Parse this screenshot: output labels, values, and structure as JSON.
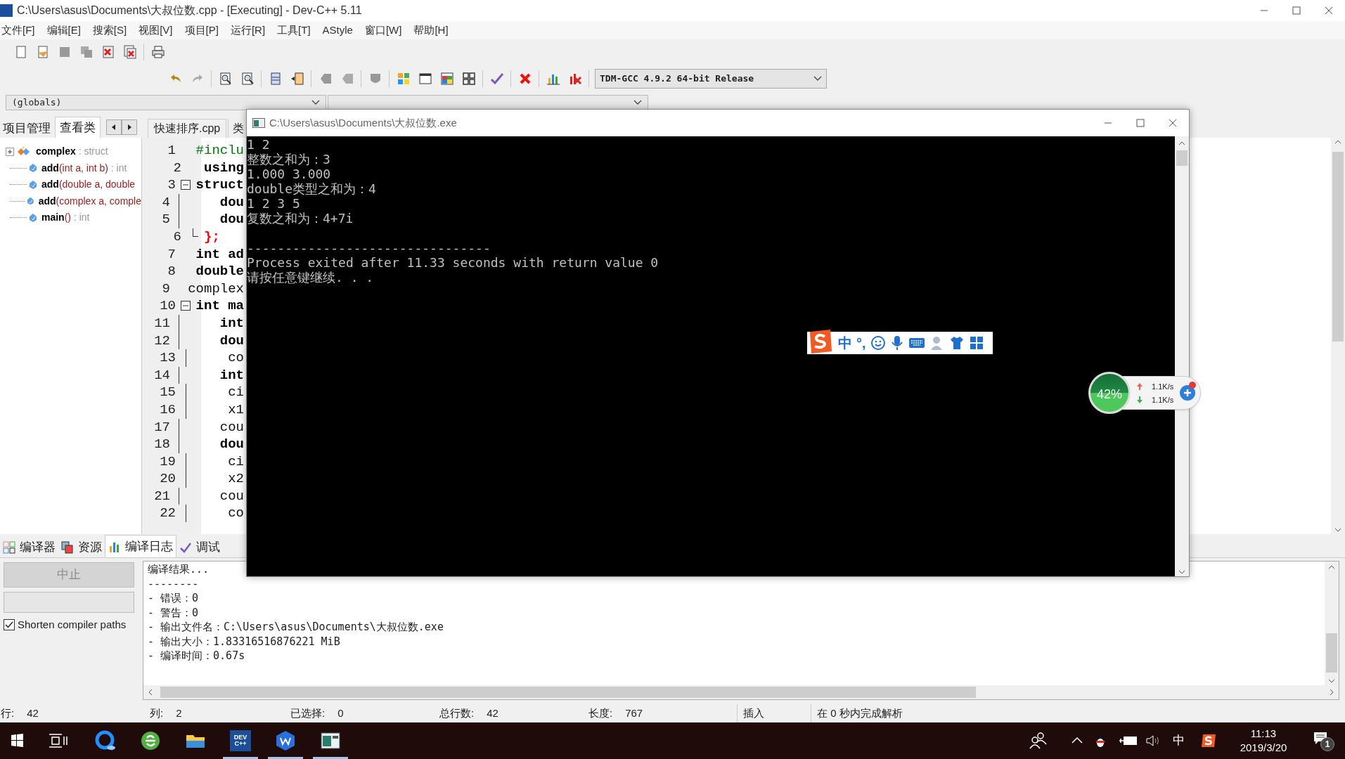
{
  "window": {
    "title": "C:\\Users\\asus\\Documents\\大叔位数.cpp - [Executing] - Dev-C++ 5.11"
  },
  "menu": [
    "文件[F]",
    "编辑[E]",
    "搜索[S]",
    "视图[V]",
    "项目[P]",
    "运行[R]",
    "工具[T]",
    "AStyle",
    "窗口[W]",
    "帮助[H]"
  ],
  "compiler_select": {
    "value": "TDM-GCC 4.9.2 64-bit Release"
  },
  "scope_select": {
    "value": "(globals)"
  },
  "left_tabs": [
    {
      "label": "项目管理",
      "selected": false
    },
    {
      "label": "查看类",
      "selected": true
    }
  ],
  "class_tree": [
    {
      "name": "complex",
      "type": ": struct",
      "kind": "struct",
      "expanded": false
    },
    {
      "name": "add",
      "params": "(int a, int b)",
      "type": ": int",
      "kind": "function"
    },
    {
      "name": "add",
      "params": "(double a, double",
      "kind": "function"
    },
    {
      "name": "add",
      "params": "(complex a, comple",
      "kind": "function"
    },
    {
      "name": "main",
      "params": "()",
      "type": ": int",
      "kind": "function"
    }
  ],
  "editor_tabs": [
    "快速排序.cpp",
    "类"
  ],
  "code_lines": [
    {
      "number": "1",
      "code": "#inclu",
      "kind": "directive",
      "fold_marker": false,
      "in_fold": false
    },
    {
      "number": "2",
      "code": "using",
      "kind": "keyword",
      "fold_marker": false,
      "in_fold": false
    },
    {
      "number": "3",
      "code": "struct",
      "kind": "keyword",
      "fold_marker": true,
      "in_fold": false
    },
    {
      "number": "4",
      "code": "    dou",
      "kind": "keyword",
      "fold_marker": false,
      "in_fold": true
    },
    {
      "number": "5",
      "code": "    dou",
      "kind": "keyword",
      "fold_marker": false,
      "in_fold": true
    },
    {
      "number": "6",
      "code": "};",
      "kind": "punct",
      "fold_marker": false,
      "in_fold": true
    },
    {
      "number": "7",
      "code": "int ad",
      "kind": "keyword",
      "fold_marker": false,
      "in_fold": false
    },
    {
      "number": "8",
      "code": "double",
      "kind": "keyword",
      "fold_marker": false,
      "in_fold": false
    },
    {
      "number": "9",
      "code": "complex",
      "kind": "plain",
      "fold_marker": false,
      "in_fold": false
    },
    {
      "number": "10",
      "code": "int ma",
      "kind": "keyword",
      "fold_marker": true,
      "in_fold": false
    },
    {
      "number": "11",
      "code": "    int",
      "kind": "keyword",
      "fold_marker": false,
      "in_fold": true
    },
    {
      "number": "12",
      "code": "    dou",
      "kind": "keyword",
      "fold_marker": false,
      "in_fold": true
    },
    {
      "number": "13",
      "code": "    co",
      "kind": "plain",
      "fold_marker": false,
      "in_fold": true
    },
    {
      "number": "14",
      "code": "    int",
      "kind": "keyword",
      "fold_marker": false,
      "in_fold": true
    },
    {
      "number": "15",
      "code": "    ci",
      "kind": "plain",
      "fold_marker": false,
      "in_fold": true
    },
    {
      "number": "16",
      "code": "    x1",
      "kind": "plain",
      "fold_marker": false,
      "in_fold": true
    },
    {
      "number": "17",
      "code": "    cou",
      "kind": "plain",
      "fold_marker": false,
      "in_fold": true
    },
    {
      "number": "18",
      "code": "    dou",
      "kind": "keyword",
      "fold_marker": false,
      "in_fold": true
    },
    {
      "number": "19",
      "code": "    ci",
      "kind": "plain",
      "fold_marker": false,
      "in_fold": true
    },
    {
      "number": "20",
      "code": "    x2",
      "kind": "plain",
      "fold_marker": false,
      "in_fold": true
    },
    {
      "number": "21",
      "code": "    cou",
      "kind": "plain",
      "fold_marker": false,
      "in_fold": true
    },
    {
      "number": "22",
      "code": "    co",
      "kind": "plain",
      "fold_marker": false,
      "in_fold": true
    }
  ],
  "console": {
    "title": "C:\\Users\\asus\\Documents\\大叔位数.exe",
    "output": [
      "1 2",
      "整数之和为：3",
      "1.000 3.000",
      "double类型之和为：4",
      "1 2 3 5",
      "复数之和为：4+7i"
    ],
    "footer": [
      "--------------------------------",
      "Process exited after 11.33 seconds with return value 0",
      "请按任意键继续. . ."
    ]
  },
  "bottom_tabs": [
    {
      "label": "编译器",
      "selected": false,
      "kind": "grid"
    },
    {
      "label": "资源",
      "selected": false,
      "kind": "pages"
    },
    {
      "label": "编译日志",
      "selected": true,
      "kind": "chart"
    },
    {
      "label": "调试",
      "selected": false,
      "kind": "check"
    }
  ],
  "abort_button": {
    "label": "中止",
    "disabled": true
  },
  "shorten_paths": {
    "label": "Shorten compiler paths",
    "checked": true
  },
  "compile_log": [
    "编译结果...",
    "--------",
    "- 错误：0",
    "- 警告：0",
    "- 输出文件名：C:\\Users\\asus\\Documents\\大叔位数.exe",
    "- 输出大小：1.83316516876221 MiB",
    "- 编译时间：0.67s"
  ],
  "status_bar": [
    {
      "label": "行:",
      "value": "42"
    },
    {
      "label": "列:",
      "value": "2"
    },
    {
      "label": "已选择:",
      "value": "0"
    },
    {
      "label": "总行数:",
      "value": "42"
    },
    {
      "label": "长度:",
      "value": "767"
    }
  ],
  "status_mode": "插入",
  "status_parse": "在 0 秒内完成解析",
  "ime_bar": {
    "mode": "中",
    "punct": "°,"
  },
  "net_widget": {
    "percent": "42%",
    "up": "1.1K/s",
    "down": "1.1K/s"
  },
  "taskbar_apps": [
    {
      "kind": "browser",
      "running": false
    },
    {
      "kind": "globe",
      "running": false
    },
    {
      "kind": "folder",
      "running": false
    },
    {
      "kind": "devcpp",
      "running": true
    },
    {
      "kind": "office",
      "running": true
    },
    {
      "kind": "console",
      "running": true
    }
  ],
  "devcpp_icon_text": [
    "DEV",
    "C++"
  ],
  "tray": {
    "ime": "中",
    "time": "11:13",
    "date": "2019/3/20",
    "notifications": "1"
  }
}
